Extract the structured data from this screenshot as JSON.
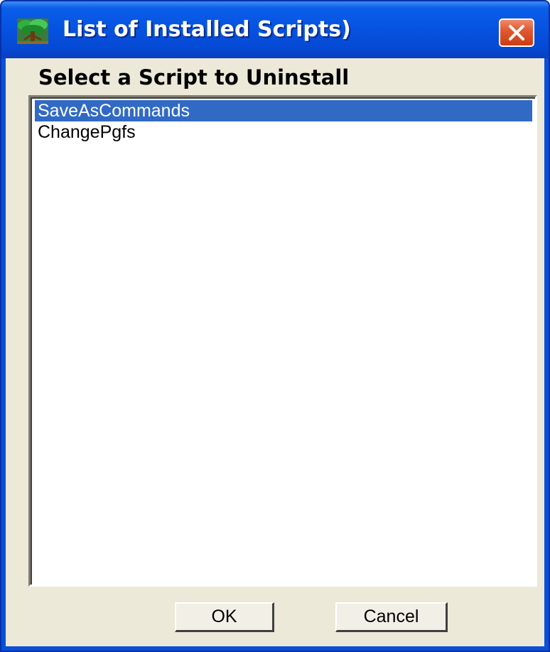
{
  "window": {
    "title": "List of Installed Scripts)",
    "icon": "tree-icon",
    "close_icon": "close-icon"
  },
  "dialog": {
    "heading": "Select a Script to Uninstall"
  },
  "script_list": {
    "items": [
      {
        "label": "SaveAsCommands",
        "selected": true
      },
      {
        "label": "ChangePgfs",
        "selected": false
      }
    ]
  },
  "buttons": {
    "ok_label": "OK",
    "cancel_label": "Cancel"
  },
  "colors": {
    "titlebar": "#0652e0",
    "client_background": "#ece9d8",
    "selection": "#316ac5",
    "close_button": "#e05a32"
  }
}
